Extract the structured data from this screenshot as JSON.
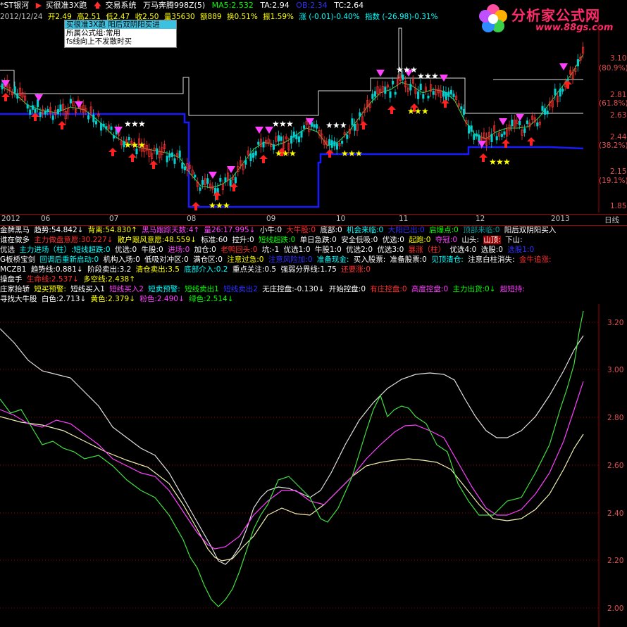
{
  "header": {
    "stock": "*ST银河",
    "formula1": "买很准3X跑",
    "formula2": "交易系统",
    "formula3": "万马奔腾998Z(5)",
    "ma5": "MA5:2.532",
    "ta": "TA:2.94",
    "ob": "OB:2.34",
    "tc": "TC:2.64"
  },
  "quote": {
    "date": "2012/12/24",
    "open": "开2.49",
    "high": "高2.51",
    "low": "低2.47",
    "close": "收2.50",
    "volume": "量35630",
    "amount": "额889",
    "turnover": "换0.51%",
    "amplitude": "振1.59%",
    "change": "涨 (-0.01)-0.40%",
    "index": "指数 (-26.98)-0.31%"
  },
  "popup": {
    "line1": "买很准3X跑 阳后双阴阳买进",
    "line2": "所属公式组:常用",
    "line3": "fs线向上不发散时买"
  },
  "logo": {
    "text": "分析家公式网",
    "url": "www.88gs.com"
  },
  "main_axis": {
    "p1": "3.10",
    "p1pct": "(80.9%)",
    "p2": "2.81",
    "p2pct": "(61.8%)",
    "p3": "2.63",
    "p4": "2.44",
    "p4pct": "(38.2%)",
    "p5": "2.15",
    "p5pct": "(19.1%)",
    "p6": "1.85"
  },
  "datebar": {
    "labels": [
      "2012",
      "06",
      "07",
      "08",
      "09",
      "10",
      "11",
      "12",
      "2013"
    ],
    "period": "日线"
  },
  "indicators": {
    "row1": [
      "金牌黑马",
      "趋势:54.842↓",
      "背离:54.830↑",
      "黑马跟踪天数:4↑",
      "量26:17.995↓",
      "小牛:0",
      "大牛股:0",
      "底部:0",
      "机会来临:0",
      "大阳已出:0",
      "启爆点:0",
      "顶部来临:0",
      "阳后双阴阳买入"
    ],
    "row2": [
      "谁在做多",
      "主力做盘意愿:30.227↓",
      "散户跟风意愿:48.559↓",
      "标准:60",
      "拉升:0",
      "短线超跌:0",
      "单日急跌:0",
      "安全低吸:0",
      "优选:0",
      "起跑:0",
      "夺冠:0",
      "山头:",
      "山顶:",
      "下山:"
    ],
    "row3": [
      "优选",
      "主力进场（柱）:短线超跌:0",
      "优选:0",
      "牛股:0",
      "进场:0",
      "加仓:0",
      "老鸭回头:0",
      "坑:-1",
      "优选1:0",
      "牛股1:0",
      "优选2:0",
      "优选3:0",
      "暴涨（柱）",
      "优选4:0",
      "选股:0",
      "选股1:0"
    ],
    "row4": [
      "G板桥宝剑",
      "回调后重新启动:0",
      "机构入场:0",
      "低吸对冲区:0",
      "满仓区:0",
      "注意过急:0",
      "注意风险加:0",
      "准备现金:",
      "买入股票:",
      "准备股票:0",
      "见顶清仓:",
      "注意白柱消失:",
      "金牛追涨:"
    ],
    "row5": [
      "MCZB1",
      "趋势线:0.881↓",
      "阶段卖出:3.2",
      "清仓卖出:3.5",
      "底部介入:0.2",
      "重点关注:0.5",
      "强弱分界线:1.75",
      "还要涨:0"
    ],
    "row6": [
      "操盘手",
      "生命线:2.537↓",
      "多空线:2.438↑"
    ],
    "row7": [
      "庄家抬轿",
      "短买预警:",
      "短线买入1",
      "短线买入2",
      "短卖预警:",
      "短线卖出1",
      "短线卖出2",
      "无庄控盘:-0.130↓",
      "开始控盘:0",
      "有庄控盘:0",
      "高度控盘:0",
      "主力出货:0↓",
      "超短持:"
    ],
    "row8": [
      "寻找大牛股",
      "白色:2.713↓",
      "黄色:2.379↓",
      "粉色:2.490↓",
      "绿色:2.514↓"
    ]
  },
  "low_axis": [
    "3.20",
    "3.00",
    "2.80",
    "2.60",
    "2.40",
    "2.20",
    "2.00"
  ]
}
